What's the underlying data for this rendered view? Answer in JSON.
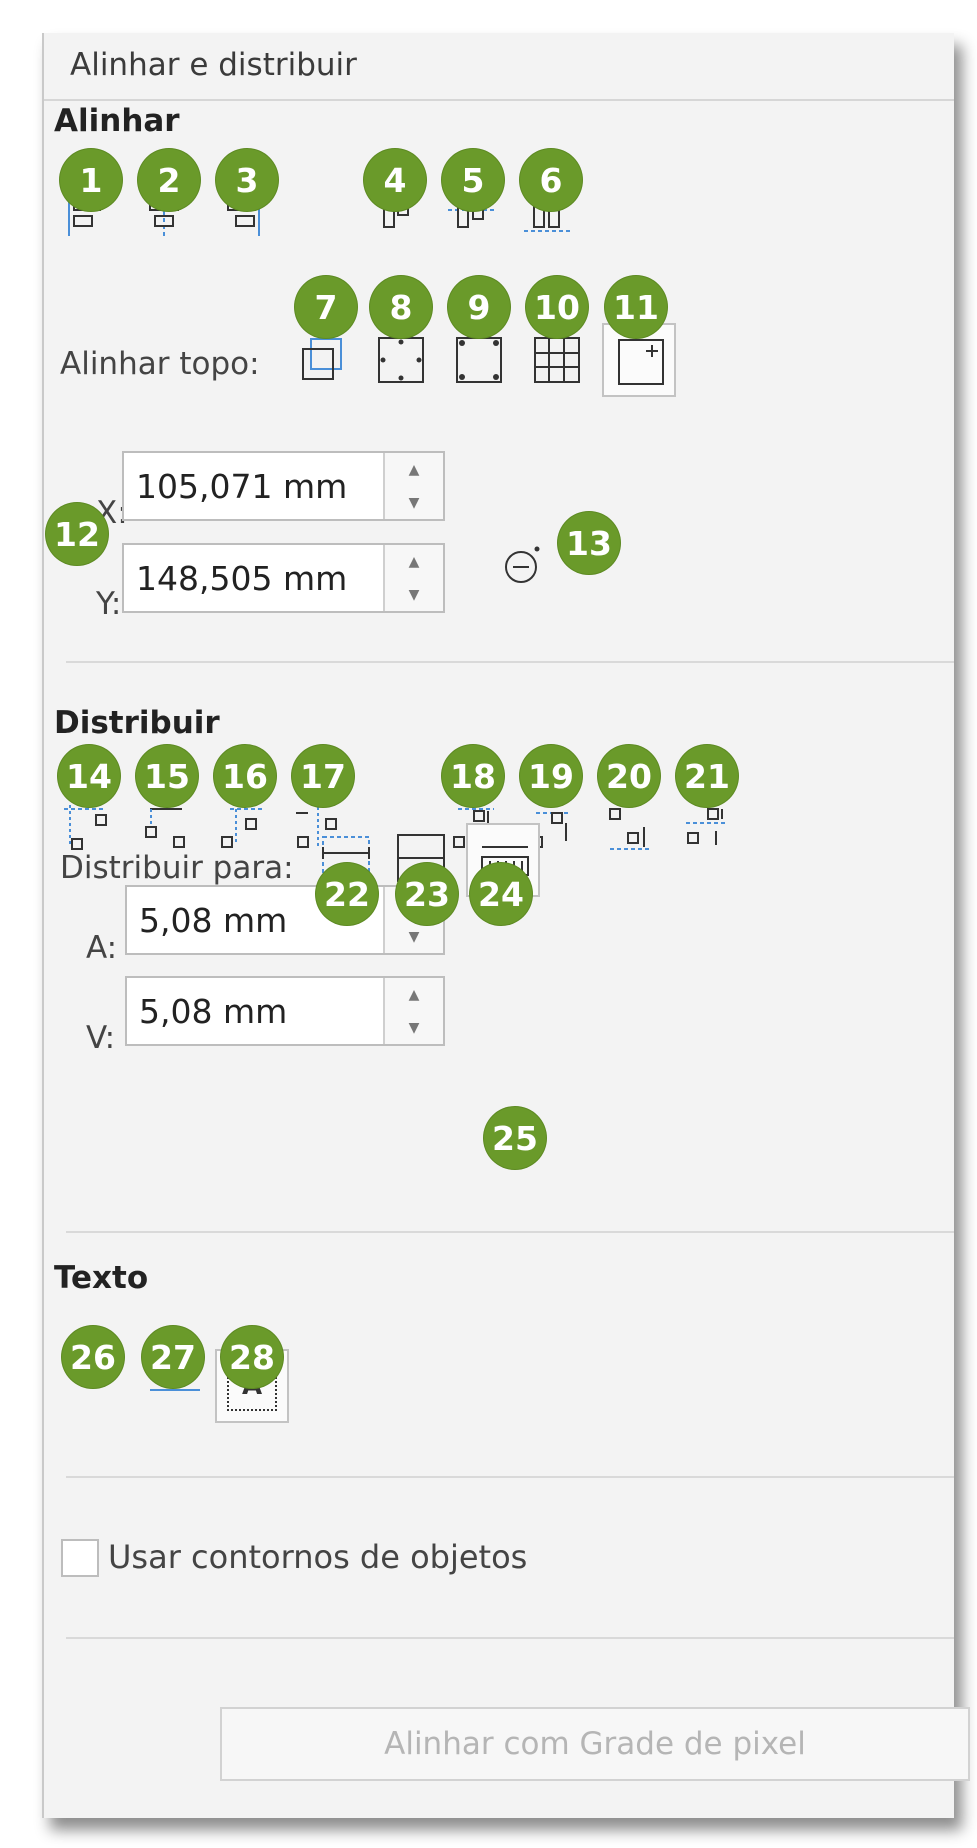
{
  "panel": {
    "title": "Alinhar e distribuir"
  },
  "align": {
    "heading": "Alinhar",
    "align_to_label": "Alinhar topo:",
    "x_label": "X:",
    "y_label": "Y:",
    "x_value": "105,071 mm",
    "y_value": "148,505 mm"
  },
  "distribute": {
    "heading": "Distribuir",
    "distribute_to_label": "Distribuir para:",
    "h_label": "A:",
    "v_label": "V:",
    "h_value": "5,08 mm",
    "v_value": "5,08 mm"
  },
  "text": {
    "heading": "Texto",
    "icon_aa": "Aa",
    "icon_bb": "bb",
    "icon_a": "A"
  },
  "options": {
    "use_outlines_label": "Usar contornos de objetos"
  },
  "buttons": {
    "align_pixel_grid": "Alinhar com Grade de pixel"
  },
  "badges": [
    "1",
    "2",
    "3",
    "4",
    "5",
    "6",
    "7",
    "8",
    "9",
    "10",
    "11",
    "12",
    "13",
    "14",
    "15",
    "16",
    "17",
    "18",
    "19",
    "20",
    "21",
    "22",
    "23",
    "24",
    "25",
    "26",
    "27",
    "28"
  ],
  "spinner": {
    "up": "▲",
    "down": "▼"
  },
  "colors": {
    "badge": "#6a9a2a",
    "guide_blue": "#4a8fd8",
    "icon_dark": "#333333"
  },
  "icons": {
    "align_left": "align-left-icon",
    "align_h_center": "align-horizontal-center-icon",
    "align_right": "align-right-icon",
    "align_top": "align-top-icon",
    "align_v_center": "align-vertical-center-icon",
    "align_bottom": "align-bottom-icon",
    "active_objects": "active-objects-icon",
    "page_edge": "page-edge-icon",
    "page_center": "page-center-icon",
    "grid": "grid-icon",
    "specified_point": "specified-point-icon",
    "pick_point": "pick-point-icon"
  }
}
